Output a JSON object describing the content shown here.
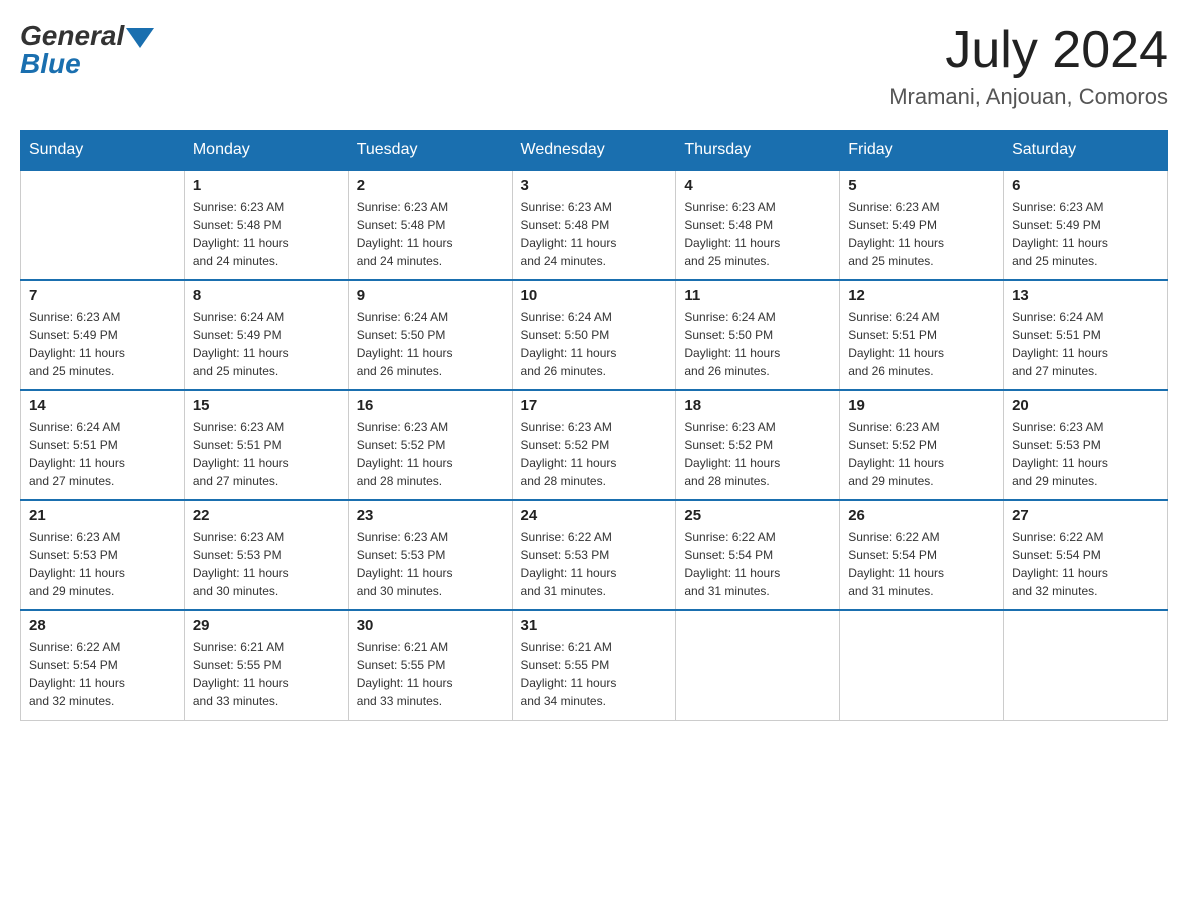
{
  "header": {
    "logo_general": "General",
    "logo_blue": "Blue",
    "month_year": "July 2024",
    "location": "Mramani, Anjouan, Comoros"
  },
  "days_of_week": [
    "Sunday",
    "Monday",
    "Tuesday",
    "Wednesday",
    "Thursday",
    "Friday",
    "Saturday"
  ],
  "weeks": [
    [
      {
        "day": "",
        "info": ""
      },
      {
        "day": "1",
        "info": "Sunrise: 6:23 AM\nSunset: 5:48 PM\nDaylight: 11 hours\nand 24 minutes."
      },
      {
        "day": "2",
        "info": "Sunrise: 6:23 AM\nSunset: 5:48 PM\nDaylight: 11 hours\nand 24 minutes."
      },
      {
        "day": "3",
        "info": "Sunrise: 6:23 AM\nSunset: 5:48 PM\nDaylight: 11 hours\nand 24 minutes."
      },
      {
        "day": "4",
        "info": "Sunrise: 6:23 AM\nSunset: 5:48 PM\nDaylight: 11 hours\nand 25 minutes."
      },
      {
        "day": "5",
        "info": "Sunrise: 6:23 AM\nSunset: 5:49 PM\nDaylight: 11 hours\nand 25 minutes."
      },
      {
        "day": "6",
        "info": "Sunrise: 6:23 AM\nSunset: 5:49 PM\nDaylight: 11 hours\nand 25 minutes."
      }
    ],
    [
      {
        "day": "7",
        "info": "Sunrise: 6:23 AM\nSunset: 5:49 PM\nDaylight: 11 hours\nand 25 minutes."
      },
      {
        "day": "8",
        "info": "Sunrise: 6:24 AM\nSunset: 5:49 PM\nDaylight: 11 hours\nand 25 minutes."
      },
      {
        "day": "9",
        "info": "Sunrise: 6:24 AM\nSunset: 5:50 PM\nDaylight: 11 hours\nand 26 minutes."
      },
      {
        "day": "10",
        "info": "Sunrise: 6:24 AM\nSunset: 5:50 PM\nDaylight: 11 hours\nand 26 minutes."
      },
      {
        "day": "11",
        "info": "Sunrise: 6:24 AM\nSunset: 5:50 PM\nDaylight: 11 hours\nand 26 minutes."
      },
      {
        "day": "12",
        "info": "Sunrise: 6:24 AM\nSunset: 5:51 PM\nDaylight: 11 hours\nand 26 minutes."
      },
      {
        "day": "13",
        "info": "Sunrise: 6:24 AM\nSunset: 5:51 PM\nDaylight: 11 hours\nand 27 minutes."
      }
    ],
    [
      {
        "day": "14",
        "info": "Sunrise: 6:24 AM\nSunset: 5:51 PM\nDaylight: 11 hours\nand 27 minutes."
      },
      {
        "day": "15",
        "info": "Sunrise: 6:23 AM\nSunset: 5:51 PM\nDaylight: 11 hours\nand 27 minutes."
      },
      {
        "day": "16",
        "info": "Sunrise: 6:23 AM\nSunset: 5:52 PM\nDaylight: 11 hours\nand 28 minutes."
      },
      {
        "day": "17",
        "info": "Sunrise: 6:23 AM\nSunset: 5:52 PM\nDaylight: 11 hours\nand 28 minutes."
      },
      {
        "day": "18",
        "info": "Sunrise: 6:23 AM\nSunset: 5:52 PM\nDaylight: 11 hours\nand 28 minutes."
      },
      {
        "day": "19",
        "info": "Sunrise: 6:23 AM\nSunset: 5:52 PM\nDaylight: 11 hours\nand 29 minutes."
      },
      {
        "day": "20",
        "info": "Sunrise: 6:23 AM\nSunset: 5:53 PM\nDaylight: 11 hours\nand 29 minutes."
      }
    ],
    [
      {
        "day": "21",
        "info": "Sunrise: 6:23 AM\nSunset: 5:53 PM\nDaylight: 11 hours\nand 29 minutes."
      },
      {
        "day": "22",
        "info": "Sunrise: 6:23 AM\nSunset: 5:53 PM\nDaylight: 11 hours\nand 30 minutes."
      },
      {
        "day": "23",
        "info": "Sunrise: 6:23 AM\nSunset: 5:53 PM\nDaylight: 11 hours\nand 30 minutes."
      },
      {
        "day": "24",
        "info": "Sunrise: 6:22 AM\nSunset: 5:53 PM\nDaylight: 11 hours\nand 31 minutes."
      },
      {
        "day": "25",
        "info": "Sunrise: 6:22 AM\nSunset: 5:54 PM\nDaylight: 11 hours\nand 31 minutes."
      },
      {
        "day": "26",
        "info": "Sunrise: 6:22 AM\nSunset: 5:54 PM\nDaylight: 11 hours\nand 31 minutes."
      },
      {
        "day": "27",
        "info": "Sunrise: 6:22 AM\nSunset: 5:54 PM\nDaylight: 11 hours\nand 32 minutes."
      }
    ],
    [
      {
        "day": "28",
        "info": "Sunrise: 6:22 AM\nSunset: 5:54 PM\nDaylight: 11 hours\nand 32 minutes."
      },
      {
        "day": "29",
        "info": "Sunrise: 6:21 AM\nSunset: 5:55 PM\nDaylight: 11 hours\nand 33 minutes."
      },
      {
        "day": "30",
        "info": "Sunrise: 6:21 AM\nSunset: 5:55 PM\nDaylight: 11 hours\nand 33 minutes."
      },
      {
        "day": "31",
        "info": "Sunrise: 6:21 AM\nSunset: 5:55 PM\nDaylight: 11 hours\nand 34 minutes."
      },
      {
        "day": "",
        "info": ""
      },
      {
        "day": "",
        "info": ""
      },
      {
        "day": "",
        "info": ""
      }
    ]
  ]
}
